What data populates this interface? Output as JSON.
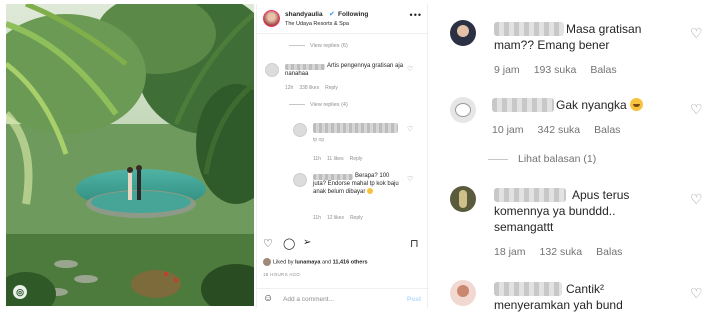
{
  "post": {
    "username": "shandyaulia",
    "following_label": "Following",
    "location": "The Udaya Resorts & Spa",
    "more_icon": "•••",
    "likes_prefix": "Liked by",
    "liker": "lunamaya",
    "likes_joiner": "and",
    "likes_count": "11,416 others",
    "timestamp": "18 HOURS AGO",
    "add_comment_placeholder": "Add a comment...",
    "post_label": "Post",
    "comments": {
      "view_replies_1": "View replies (6)",
      "c1_text": "Artis pengennya gratisan aja nanahaa",
      "c1_time": "12h",
      "c1_likes": "338 likes",
      "c1_reply": "Reply",
      "view_replies_2": "View replies (4)",
      "c2_text": "tp op",
      "c2_time": "11h",
      "c2_likes": "11 likes",
      "c2_reply": "Reply",
      "c3_text": "Berapa? 100 juta? Endorse mahal tp kok baju anak belum dibayar",
      "c3_time": "11h",
      "c3_likes": "12 likes",
      "c3_reply": "Reply"
    }
  },
  "zoom": {
    "c1": {
      "text": "Masa gratisan mam?? Emang bener",
      "time": "9 jam",
      "likes": "193 suka",
      "reply": "Balas"
    },
    "c2": {
      "text": "Gak nyangka",
      "time": "10 jam",
      "likes": "342 suka",
      "reply": "Balas"
    },
    "view_replies": "Lihat balasan (1)",
    "c3": {
      "text": "Apus terus komennya ya bunddd.. semangattt",
      "time": "18 jam",
      "likes": "132 suka",
      "reply": "Balas"
    },
    "c4": {
      "text": "Cantik² menyeramkan yah bund"
    }
  }
}
